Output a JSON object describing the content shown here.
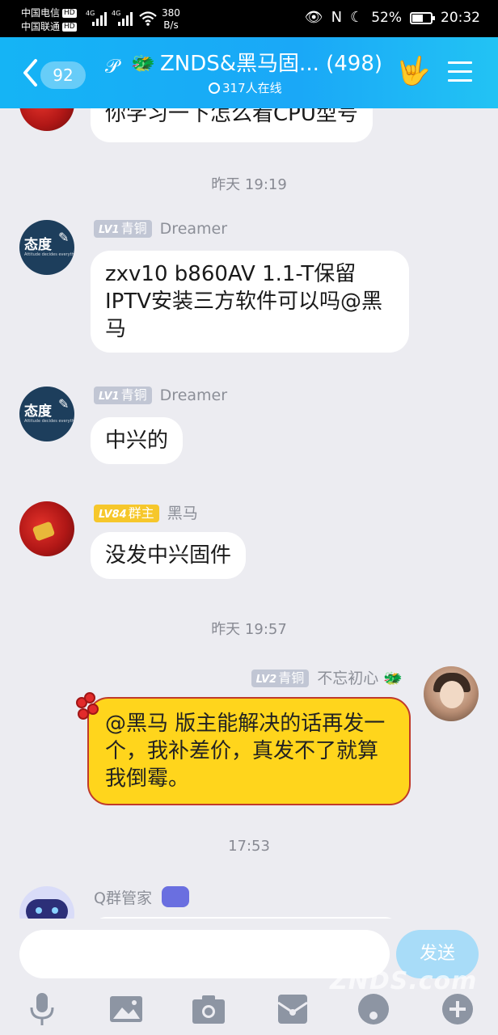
{
  "status_bar": {
    "carrier1": "中国电信",
    "carrier2": "中国联通",
    "hd": "HD",
    "net1": "4G",
    "net2": "4G",
    "speed_value": "380",
    "speed_unit": "B/s",
    "battery": "52%",
    "time": "20:32"
  },
  "header": {
    "unread_count": "92",
    "title": "ZNDS&黑马固... (498)",
    "online": "317人在线"
  },
  "chat": {
    "partial_top_text": "你学习一下怎么看CPU型号",
    "timestamps": [
      "昨天 19:19",
      "昨天 19:57",
      "17:53"
    ],
    "messages": [
      {
        "level": "LV1",
        "title": "青铜",
        "name": "Dreamer",
        "text": "zxv10 b860AV 1.1-T保留IPTV安装三方软件可以吗@黑马"
      },
      {
        "level": "LV1",
        "title": "青铜",
        "name": "Dreamer",
        "text": "中兴的"
      },
      {
        "level": "LV84",
        "title": "群主",
        "name": "黑马",
        "text": "没发中兴固件"
      },
      {
        "level": "LV2",
        "title": "青铜",
        "name": "不忘初心",
        "text": "@黑马 版主能解决的话再发一个，我补差价，真发不了就算我倒霉。"
      }
    ],
    "bot_name": "Q群管家",
    "avatar_text": "态度"
  },
  "input": {
    "send_label": "发送",
    "watermark": "ZNDS.com"
  }
}
